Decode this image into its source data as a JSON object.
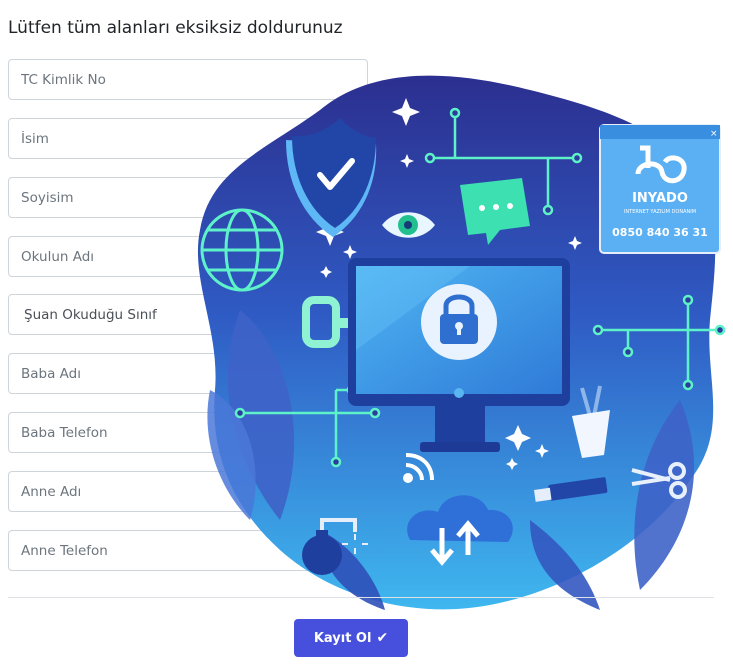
{
  "form": {
    "title": "Lütfen tüm alanları eksiksiz doldurunuz",
    "fields": [
      {
        "placeholder": "TC Kimlik No"
      },
      {
        "placeholder": "İsim"
      },
      {
        "placeholder": "Soyisim"
      },
      {
        "placeholder": "Okulun Adı"
      },
      {
        "selected": "Şuan Okuduğu Sınıf"
      },
      {
        "placeholder": "Baba Adı"
      },
      {
        "placeholder": "Baba Telefon"
      },
      {
        "placeholder": "Anne Adı"
      },
      {
        "placeholder": "Anne Telefon"
      }
    ],
    "submit_label": "Kayıt Ol",
    "submit_icon": "checkmark-icon"
  },
  "illustration": {
    "brand_name": "INYADO",
    "brand_tagline": "INTERNET YAZILIM DONANIM",
    "brand_phone": "0850 840 36 31",
    "colors": {
      "accent": "#4650dc",
      "blob_dark": "#2f3aa8",
      "blob_light": "#3fb0ec",
      "circuit": "#5ef2c9"
    }
  }
}
